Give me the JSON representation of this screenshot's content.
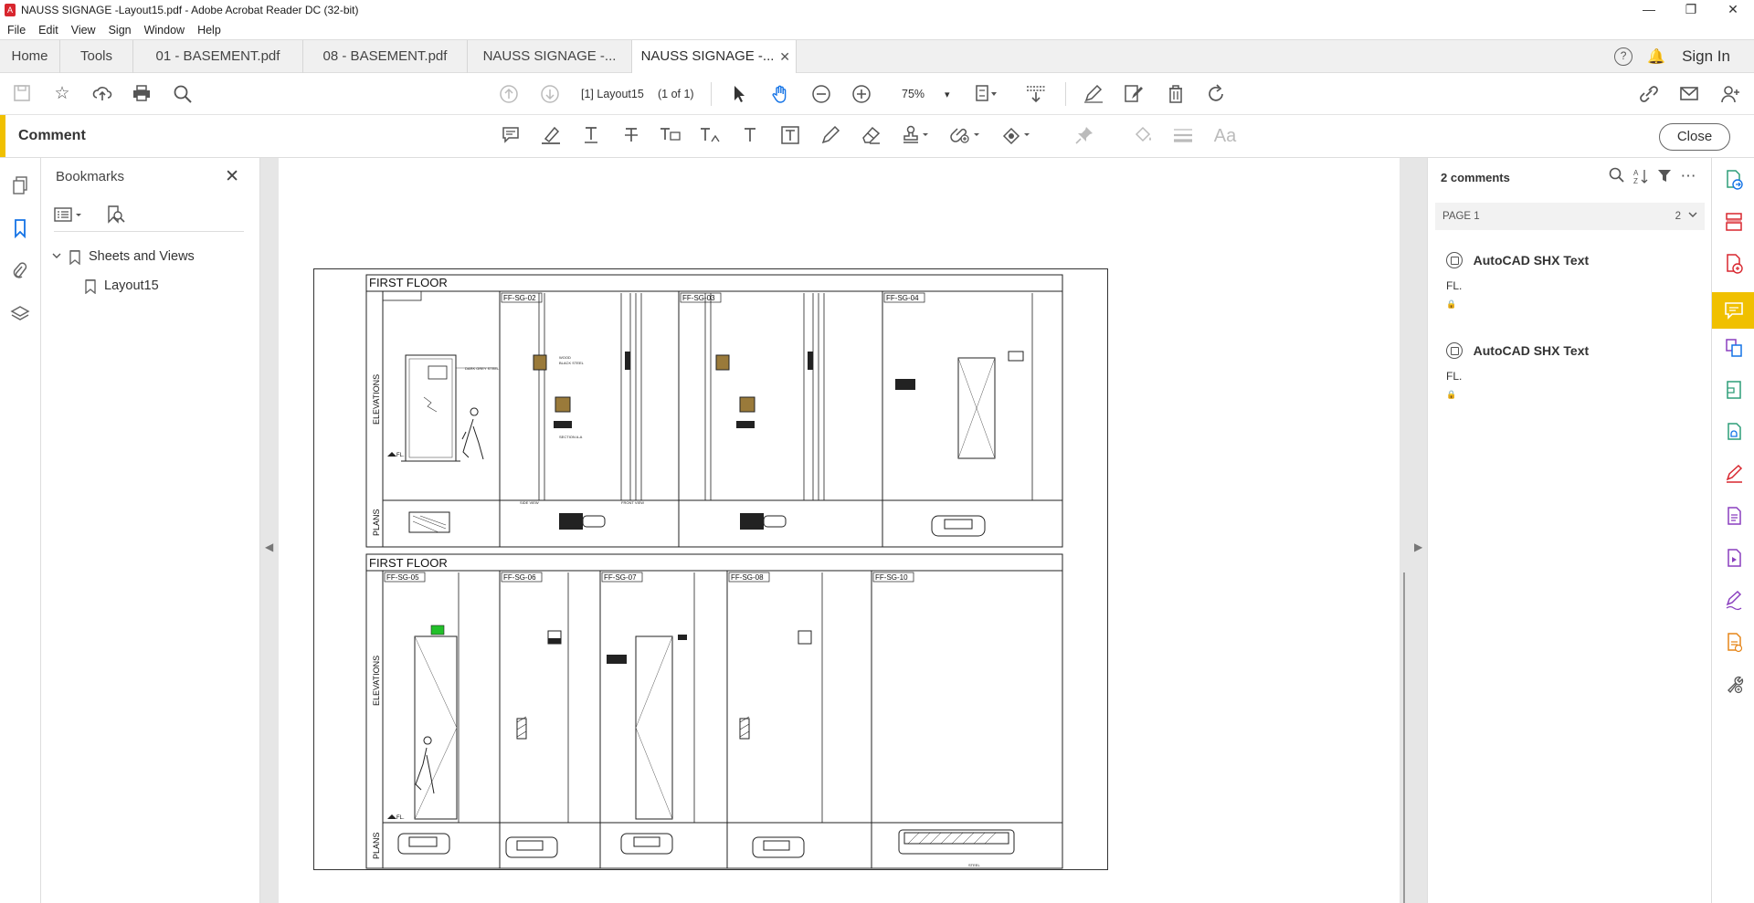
{
  "window": {
    "title": "NAUSS SIGNAGE -Layout15.pdf - Adobe Acrobat Reader DC (32-bit)",
    "app_icon": "acrobat-icon",
    "controls": [
      "—",
      "❐",
      "✕"
    ]
  },
  "menu": [
    "File",
    "Edit",
    "View",
    "Sign",
    "Window",
    "Help"
  ],
  "tabs": {
    "home": "Home",
    "tools": "Tools",
    "documents": [
      "01 - BASEMENT.pdf",
      "08 - BASEMENT.pdf",
      "NAUSS SIGNAGE -...",
      "NAUSS SIGNAGE -..."
    ],
    "active_index": 3,
    "close_glyph": "✕",
    "help_glyph": "?",
    "sign_in": "Sign In"
  },
  "toolbar": {
    "page_label": "[1] Layout15",
    "page_count": "(1 of 1)",
    "zoom": "75%",
    "zoom_caret": "▾"
  },
  "comment_bar": {
    "label": "Comment",
    "close": "Close"
  },
  "bookmarks": {
    "title": "Bookmarks",
    "close_glyph": "✕",
    "items": [
      {
        "label": "Sheets and Views",
        "expanded": true
      },
      {
        "label": "Layout15",
        "expanded": false
      }
    ]
  },
  "drawing": {
    "section1_title": "FIRST FLOOR",
    "section2_title": "FIRST FLOOR",
    "row_labels": [
      "ELEVATIONS",
      "PLANS"
    ],
    "tags_top": [
      "FF-SG-02",
      "FF-SG-03",
      "FF-SG-04"
    ],
    "tags_bottom": [
      "FF-SG-05",
      "FF-SG-06",
      "FF-SG-07",
      "FF-SG-08",
      "FF-SG-10"
    ],
    "fl_label": "FL.",
    "side_view": "SIDE VIEW",
    "front_view": "FRONT VIEW",
    "section_aa": "SECTION A-A",
    "wood": "WOOD",
    "black_steel": "BLACK STEEL",
    "dark_grey_steel": "DARK GREY STEEL",
    "steel": "STEEL"
  },
  "comments": {
    "count_label": "2 comments",
    "page_group": "PAGE 1",
    "page_group_count": "2",
    "items": [
      {
        "author": "AutoCAD SHX Text",
        "text": "FL."
      },
      {
        "author": "AutoCAD SHX Text",
        "text": "FL."
      }
    ]
  },
  "colors": {
    "accent_yellow": "#f0c000",
    "bookmark_blue": "#1473e6",
    "rail_red": "#d8262e",
    "rail_purple": "#8a3fbf",
    "rail_blue": "#1473e6",
    "rail_green": "#2d9d78",
    "rail_orange": "#e68619",
    "sign_green": "#22c02a"
  }
}
